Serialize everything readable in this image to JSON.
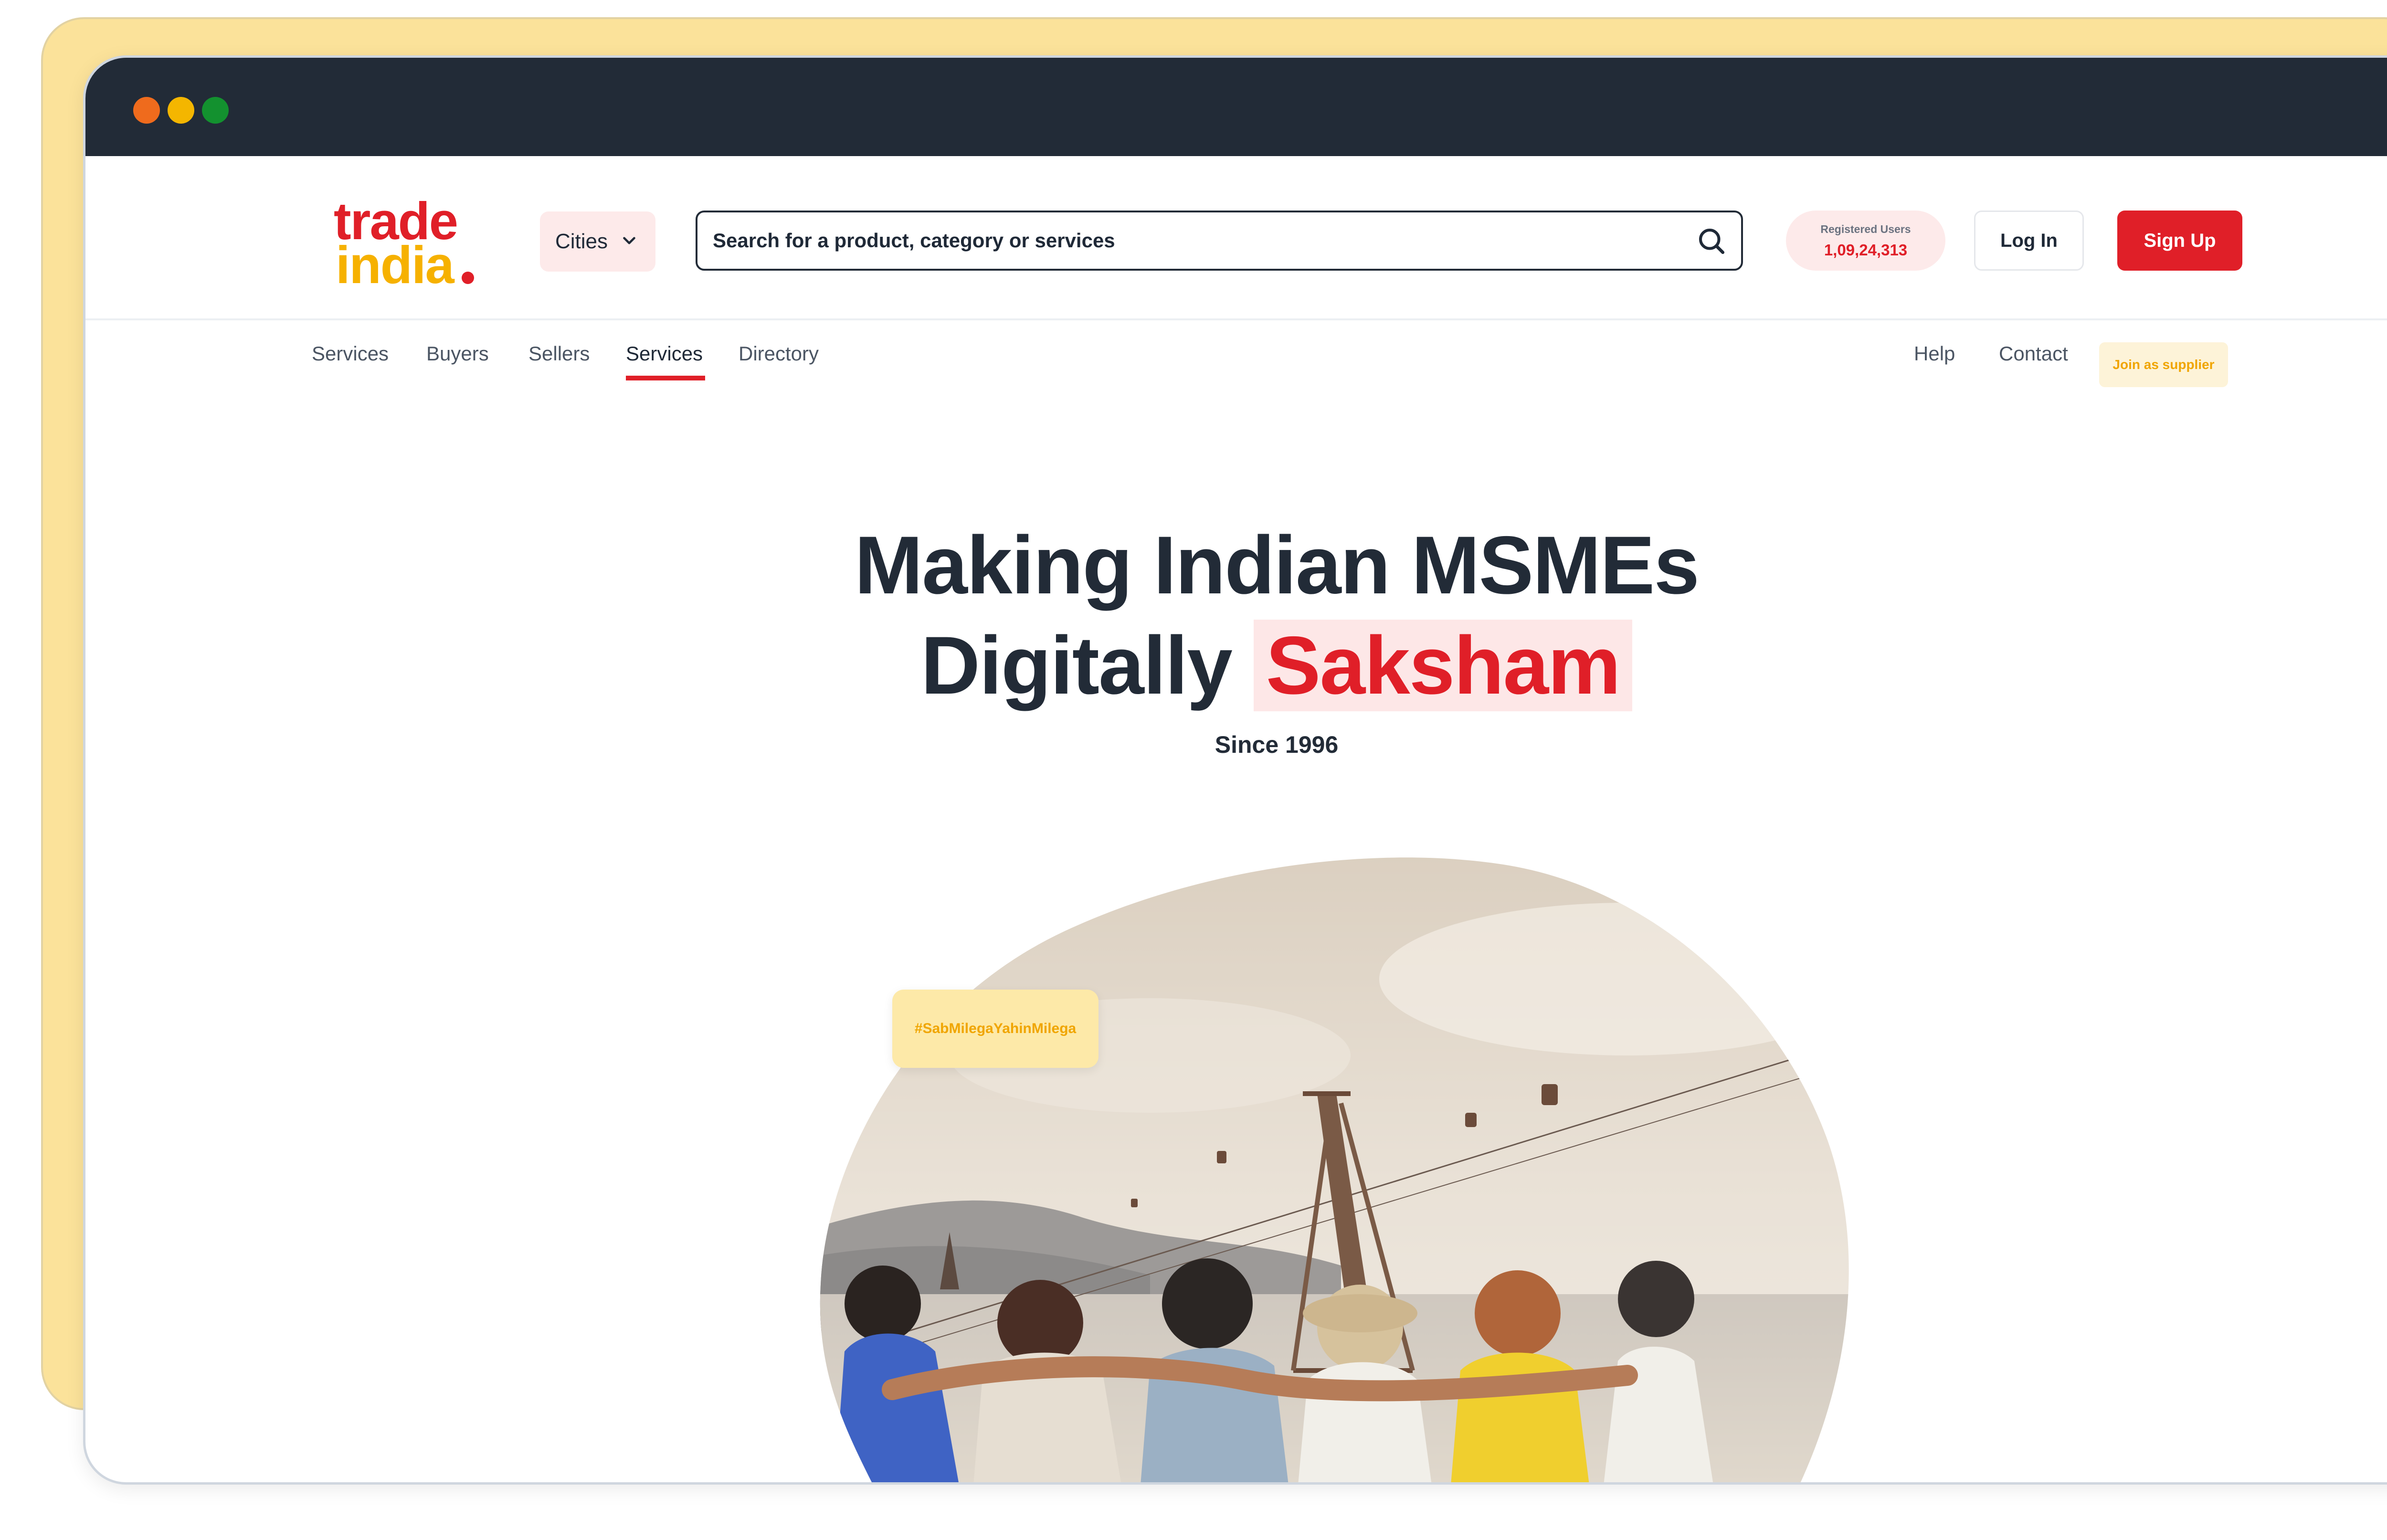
{
  "logo": {
    "line1": "trade",
    "line2": "india"
  },
  "header": {
    "cities_label": "Cities",
    "search_placeholder": "Search for a product, category or services",
    "registered_label": "Registered Users",
    "registered_count": "1,09,24,313",
    "login_label": "Log In",
    "signup_label": "Sign Up"
  },
  "nav": {
    "left": [
      "Services",
      "Buyers",
      "Sellers",
      "Services",
      "Directory"
    ],
    "active_index": 3,
    "right": [
      "Help",
      "Contact"
    ],
    "join_label": "Join as supplier"
  },
  "hero": {
    "title_line1": "Making Indian MSMEs",
    "title_line2_prefix": "Digitally",
    "title_highlight": "Saksham",
    "subtitle": "Since 1996",
    "hashtag": "#SabMilegaYahinMilega"
  },
  "colors": {
    "brand_red": "#e01f28",
    "brand_yellow": "#f6b100",
    "dark": "#222b37"
  },
  "icons": [
    "chevron-down-icon",
    "search-icon"
  ]
}
